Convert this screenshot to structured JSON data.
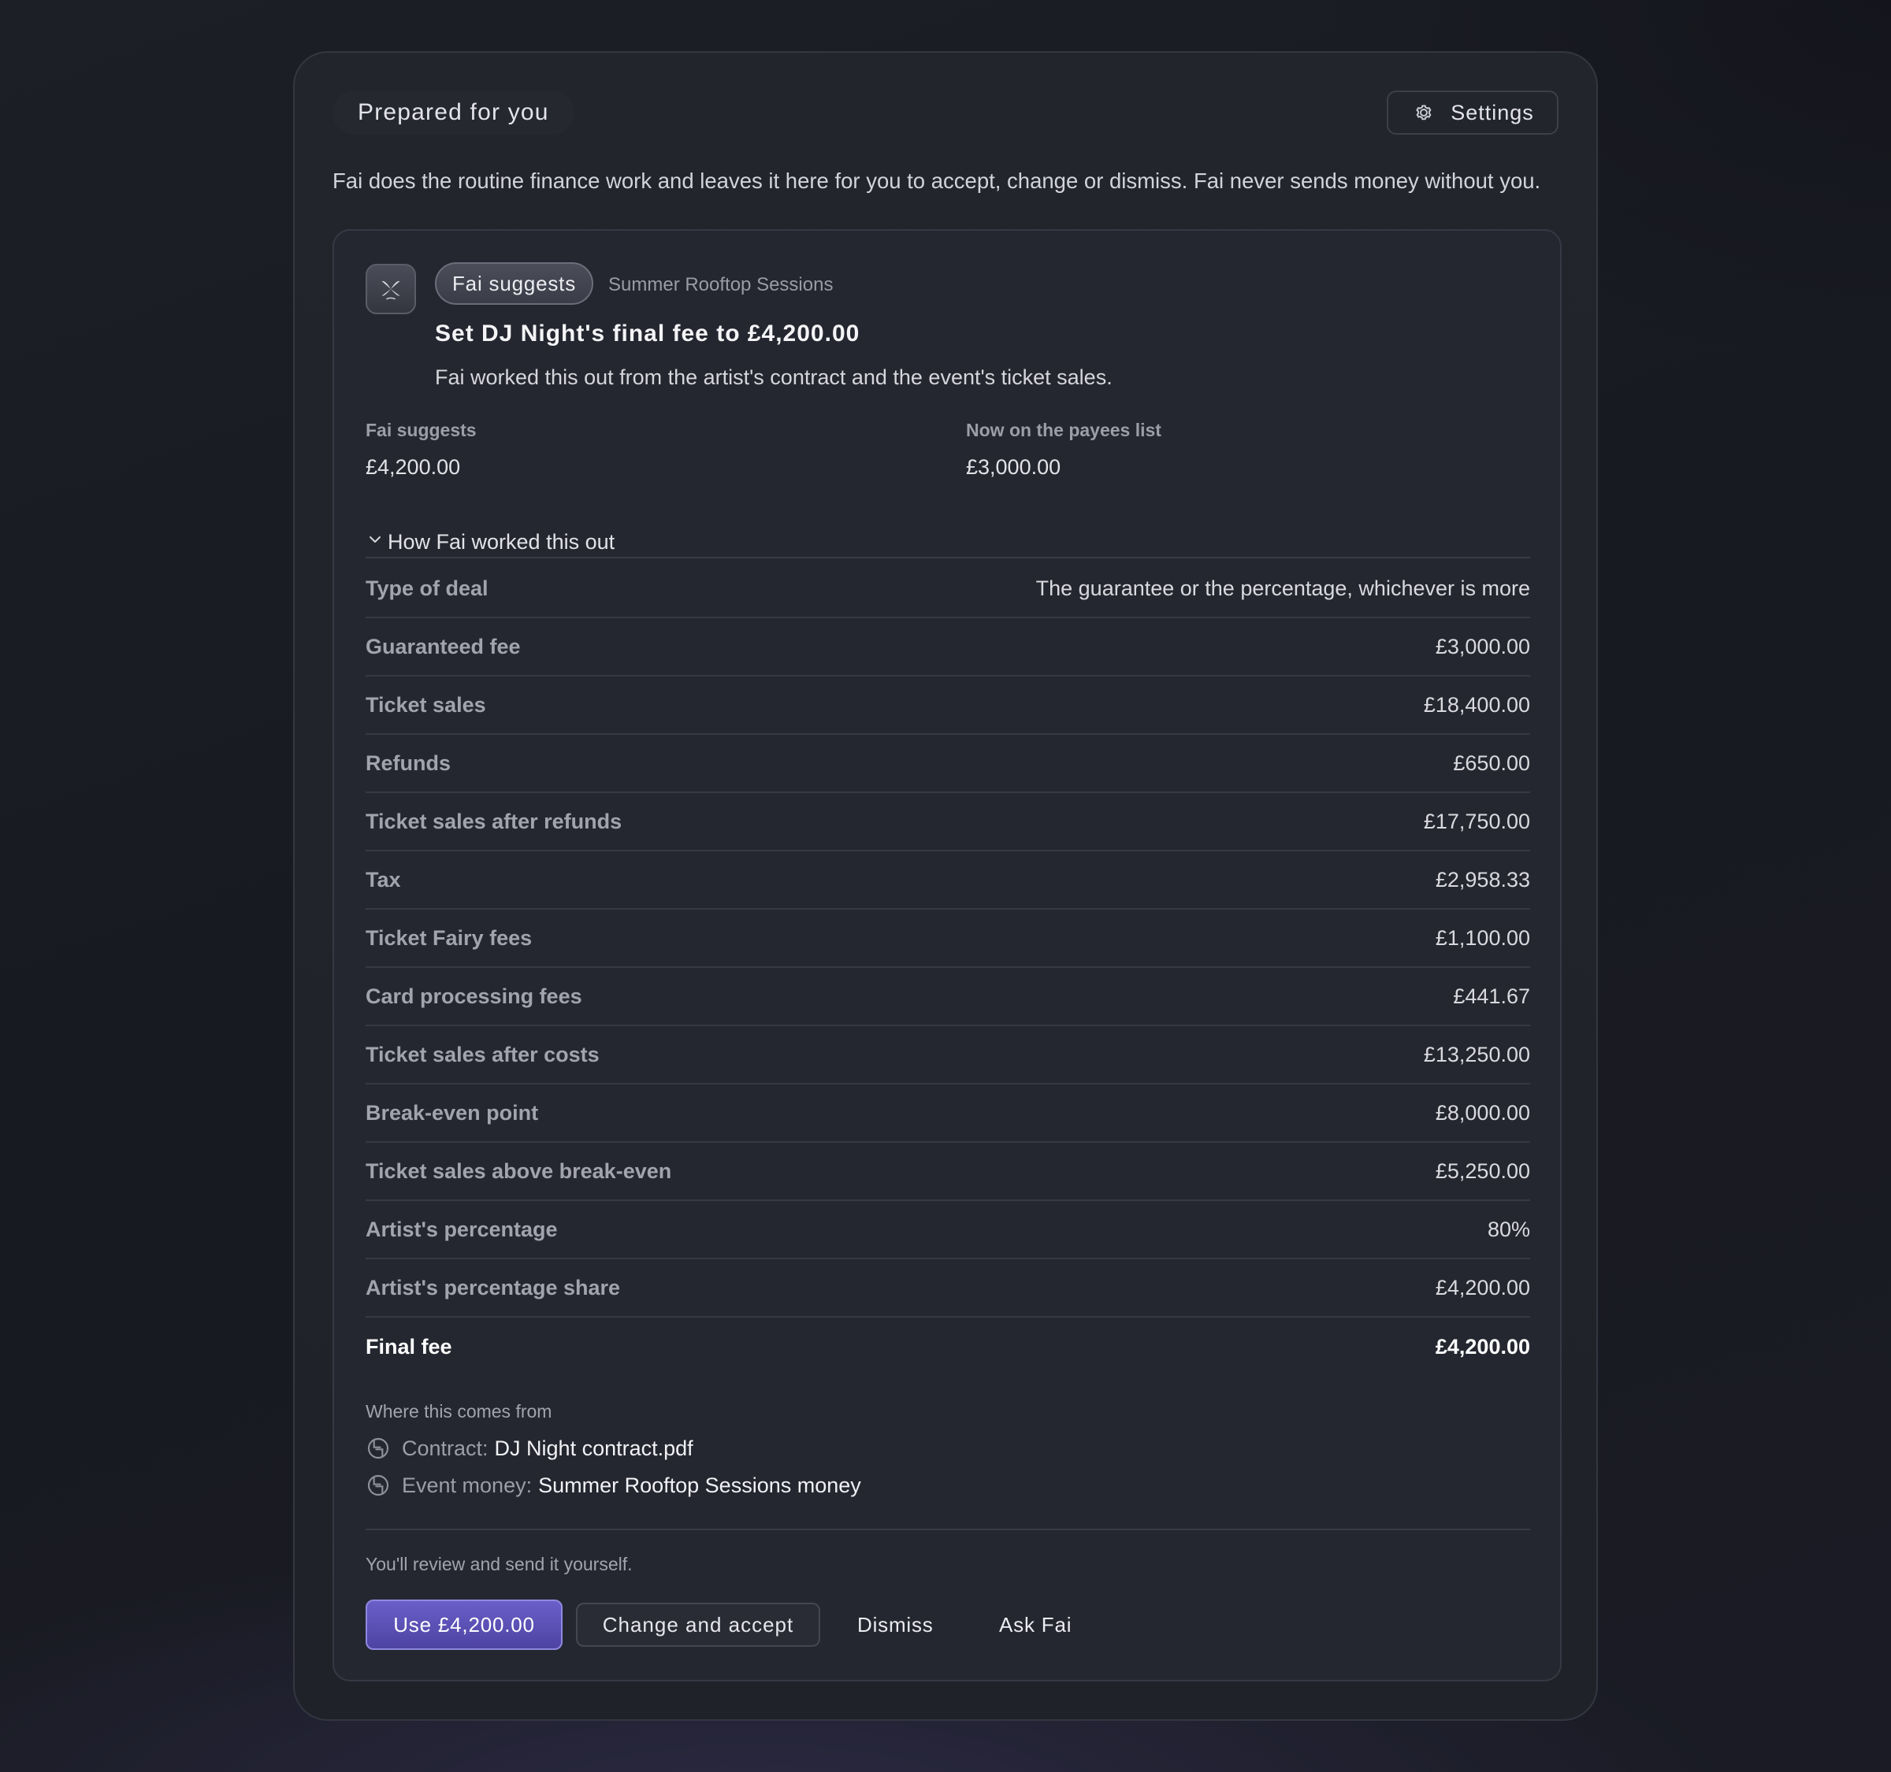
{
  "header": {
    "pill_label": "Prepared for you",
    "settings_label": "Settings",
    "intro": "Fai does the routine finance work and leaves it here for you to accept, change or dismiss. Fai never sends money without you."
  },
  "suggestion": {
    "badge": "Fai suggests",
    "event": "Summer Rooftop Sessions",
    "title": "Set DJ Night's final fee to £4,200.00",
    "subtitle": "Fai worked this out from the artist's contract and the event's ticket sales.",
    "compare": [
      {
        "label": "Fai suggests",
        "value": "£4,200.00"
      },
      {
        "label": "Now on the payees list",
        "value": "£3,000.00"
      }
    ],
    "how_label": "How Fai worked this out",
    "rows": [
      {
        "label": "Type of deal",
        "value": "The guarantee or the percentage, whichever is more"
      },
      {
        "label": "Guaranteed fee",
        "value": "£3,000.00"
      },
      {
        "label": "Ticket sales",
        "value": "£18,400.00"
      },
      {
        "label": "Refunds",
        "value": "£650.00"
      },
      {
        "label": "Ticket sales after refunds",
        "value": "£17,750.00"
      },
      {
        "label": "Tax",
        "value": "£2,958.33"
      },
      {
        "label": "Ticket Fairy fees",
        "value": "£1,100.00"
      },
      {
        "label": "Card processing fees",
        "value": "£441.67"
      },
      {
        "label": "Ticket sales after costs",
        "value": "£13,250.00"
      },
      {
        "label": "Break-even point",
        "value": "£8,000.00"
      },
      {
        "label": "Ticket sales above break-even",
        "value": "£5,250.00"
      },
      {
        "label": "Artist's percentage",
        "value": "80%"
      },
      {
        "label": "Artist's percentage share",
        "value": "£4,200.00"
      },
      {
        "label": "Final fee",
        "value": "£4,200.00"
      }
    ],
    "sources_title": "Where this comes from",
    "sources": [
      {
        "prefix": "Contract:",
        "name": "DJ Night contract.pdf"
      },
      {
        "prefix": "Event money:",
        "name": "Summer Rooftop Sessions money"
      }
    ],
    "note": "You'll review and send it yourself.",
    "actions": {
      "primary": "Use £4,200.00",
      "change": "Change and accept",
      "dismiss": "Dismiss",
      "ask": "Ask Fai"
    }
  },
  "icons": [
    "gear-icon",
    "fai-logo-icon",
    "chevron-down-icon",
    "link-icon"
  ],
  "colors": {
    "accent": "#5d52b8",
    "background": "#1b1d24",
    "card": "#252730"
  }
}
